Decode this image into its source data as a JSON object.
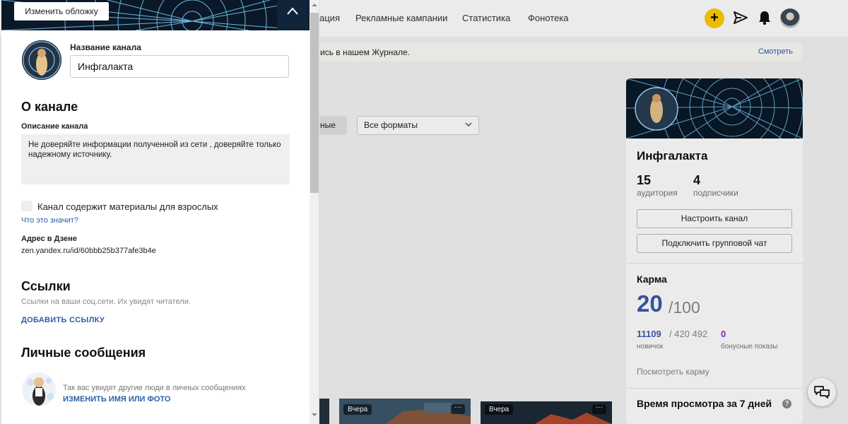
{
  "nav": {
    "items": [
      {
        "label": "ация"
      },
      {
        "label": "Рекламные кампании"
      },
      {
        "label": "Статистика"
      },
      {
        "label": "Фонотека"
      }
    ],
    "add_label": "+"
  },
  "banner": {
    "text": "ись в нашем Журнале.",
    "link": "Смотреть"
  },
  "filters": {
    "tab_partial": "ные",
    "formats": "Все форматы"
  },
  "feed": {
    "thumbs": [
      {
        "date": "Вчера",
        "more": "···"
      },
      {
        "date": "Вчера",
        "more": "···"
      }
    ]
  },
  "card": {
    "channel_name": "Инфгалакта",
    "stats": [
      {
        "value": "15",
        "label": "аудитория"
      },
      {
        "value": "4",
        "label": "подписчики"
      }
    ],
    "setup_button": "Настроить канал",
    "group_chat_button": "Подключить групповой чат",
    "karma": {
      "title": "Карма",
      "value": "20",
      "max": "/100",
      "novice_value": "11109",
      "novice_total": "/ 420 492",
      "novice_label": "новичок",
      "bonus_value": "0",
      "bonus_label": "бонусные показы",
      "link": "Посмотреть карму"
    },
    "watch_time_title": "Время просмотра за 7 дней",
    "help": "?"
  },
  "panel": {
    "change_cover": "Изменить обложку",
    "channel_name_label": "Название канала",
    "channel_name_value": "Инфгалакта",
    "about_title": "О канале",
    "description_label": "Описание канала",
    "description": "Не доверяйте информации полученной из сети , доверяйте только надежному источнику.",
    "adult_label": "Канал содержит материалы для взрослых",
    "adult_checked": false,
    "what_link": "Что это значит?",
    "address_label": "Адрес в Дзене",
    "address_value": "zen.yandex.ru/id/60bbb25b377afe3b4e",
    "links_title": "Ссылки",
    "links_hint": "Ссылки на ваши соц.сети. Их увидят читатели.",
    "add_link": "ДОБАВИТЬ ССЫЛКУ",
    "pm_title": "Личные сообщения",
    "pm_hint": "Так вас увидят другие люди в личных сообщениях",
    "pm_change": "ИЗМЕНИТЬ ИМЯ ИЛИ ФОТО"
  },
  "colors": {
    "accent_yellow": "#ffcc00",
    "link_blue": "#2b5ea8",
    "karma_blue": "#3a5bb0",
    "bonus_purple": "#8b2fc9"
  },
  "icons": [
    "send-icon",
    "bell-icon",
    "chevron-down-icon",
    "help-icon",
    "chat-icon"
  ]
}
